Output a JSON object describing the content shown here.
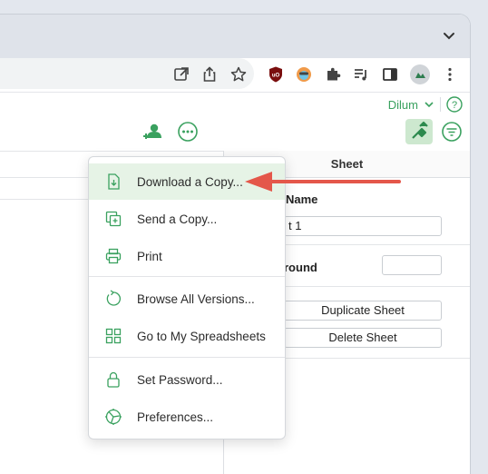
{
  "browser": {
    "extensions": [
      "open-in-new-icon",
      "share-icon",
      "star-icon",
      "ublock-icon",
      "fox-extension-icon",
      "puzzle-icon",
      "playlist-icon",
      "sidepanel-icon",
      "profile-avatar",
      "more-vert-icon"
    ]
  },
  "app": {
    "user_name": "Dilum",
    "panel_title": "Sheet",
    "sheet_name_label": "Name",
    "sheet_name_value": "t 1",
    "background_label": "round",
    "duplicate_label": "Duplicate Sheet",
    "delete_label": "Delete Sheet"
  },
  "menu": {
    "items": [
      {
        "label": "Download a Copy...",
        "icon": "download-icon",
        "highlighted": true
      },
      {
        "label": "Send a Copy...",
        "icon": "copy-icon"
      },
      {
        "label": "Print",
        "icon": "printer-icon"
      },
      {
        "label": "Browse All Versions...",
        "icon": "history-icon"
      },
      {
        "label": "Go to My Spreadsheets",
        "icon": "grid-icon"
      },
      {
        "label": "Set Password...",
        "icon": "lock-icon"
      },
      {
        "label": "Preferences...",
        "icon": "settings-icon"
      }
    ]
  },
  "colors": {
    "accent": "#3aa15f",
    "highlight": "#e6f3e6",
    "annotation_arrow": "#e4574a"
  }
}
